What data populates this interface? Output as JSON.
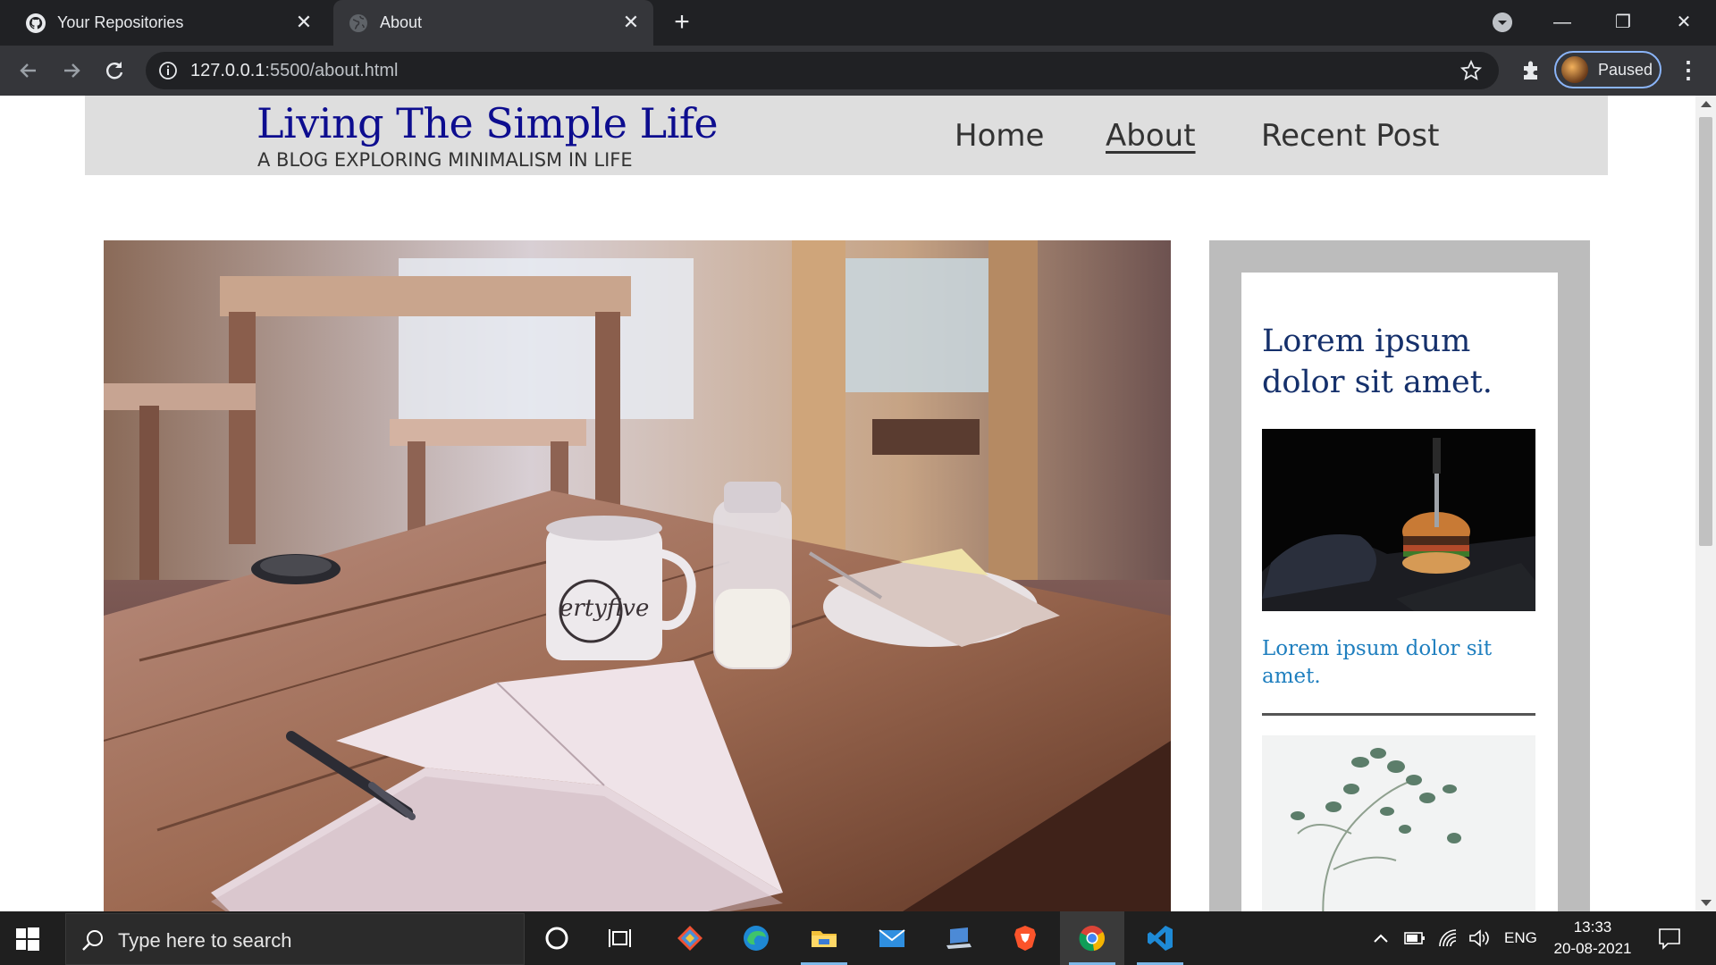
{
  "browser": {
    "tabs": [
      {
        "title": "Your Repositories",
        "favicon": "github-icon",
        "active": false
      },
      {
        "title": "About",
        "favicon": "globe-icon",
        "active": true
      }
    ],
    "url_host": "127.0.0.1",
    "url_rest": ":5500/about.html",
    "profile_status": "Paused",
    "colors": {
      "frame": "#202124",
      "toolbar": "#35363a",
      "accent": "#8ab4f8"
    }
  },
  "site": {
    "title": "Living The Simple Life",
    "tagline": "A BLOG EXPLORING MINIMALISM IN LIFE",
    "nav": [
      {
        "label": "Home",
        "current": false
      },
      {
        "label": "About",
        "current": true
      },
      {
        "label": "Recent Post",
        "current": false
      }
    ],
    "sidebar": {
      "heading": "Lorem ipsum dolor sit amet.",
      "post_link": "Lorem ipsum dolor sit amet."
    },
    "colors": {
      "title": "#0d0d8f",
      "header_bg": "#dedede",
      "sidebar_bg": "#bcbcbc",
      "heading": "#15306b",
      "link": "#1f7fbf"
    }
  },
  "taskbar": {
    "search_placeholder": "Type here to search",
    "apps": [
      "cortana-icon",
      "task-view-icon",
      "git-icon",
      "edge-icon",
      "file-explorer-icon",
      "mail-icon",
      "laptop-icon",
      "brave-icon",
      "chrome-icon",
      "vscode-icon"
    ],
    "language": "ENG",
    "time": "13:33",
    "date": "20-08-2021"
  }
}
